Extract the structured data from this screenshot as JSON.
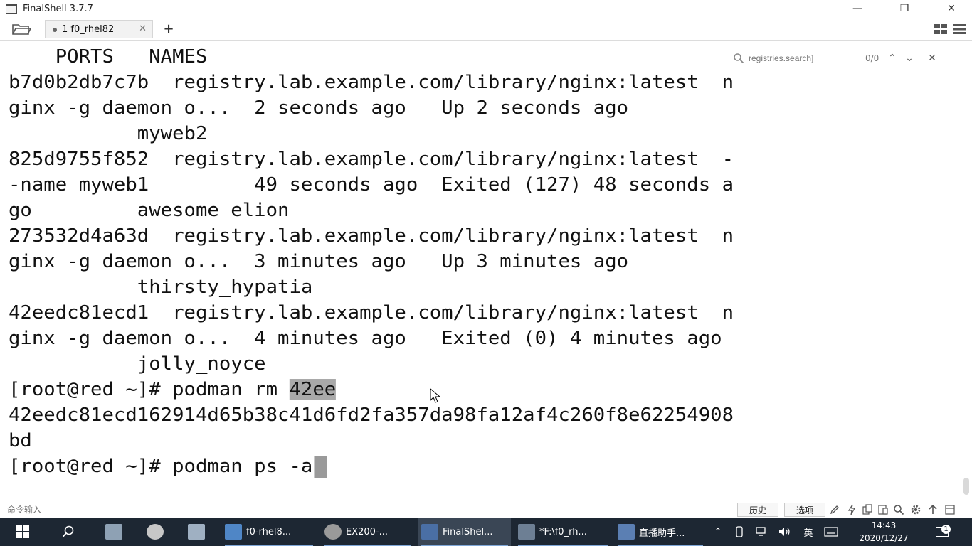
{
  "window": {
    "title": "FinalShell 3.7.7",
    "minimize": "—",
    "maximize": "❐",
    "close": "✕"
  },
  "tabs": [
    {
      "label": "1 f0_rhel82",
      "close": "✕"
    }
  ],
  "add_tab": "+",
  "search": {
    "placeholder": "registries.search]",
    "count": "0/0",
    "prev": "⌃",
    "next": "⌄",
    "close": "✕"
  },
  "terminal": {
    "lines": [
      "    PORTS   NAMES",
      "b7d0b2db7c7b  registry.lab.example.com/library/nginx:latest  n",
      "ginx -g daemon o...  2 seconds ago   Up 2 seconds ago",
      "           myweb2",
      "825d9755f852  registry.lab.example.com/library/nginx:latest  -",
      "-name myweb1         49 seconds ago  Exited (127) 48 seconds a",
      "go         awesome_elion",
      "273532d4a63d  registry.lab.example.com/library/nginx:latest  n",
      "ginx -g daemon o...  3 minutes ago   Up 3 minutes ago",
      "           thirsty_hypatia",
      "42eedc81ecd1  registry.lab.example.com/library/nginx:latest  n",
      "ginx -g daemon o...  4 minutes ago   Exited (0) 4 minutes ago",
      "           jolly_noyce",
      "",
      "42eedc81ecd162914d65b38c41d6fd2fa357da98fa12af4c260f8e62254908",
      "bd",
      ""
    ],
    "rm_prompt": "[root@red ~]# podman rm ",
    "rm_selected": "42ee",
    "ps_prompt": "[root@red ~]# podman ps -a"
  },
  "command_bar": {
    "placeholder": "命令输入",
    "history_label": "历史",
    "options_label": "选项"
  },
  "taskbar": {
    "apps": [
      {
        "label": "f0-rhel8...",
        "color": "#4f86c6"
      },
      {
        "label": "EX200-...",
        "color": "#9a9a9a"
      },
      {
        "label": "FinalShel...",
        "color": "#4a6fa5"
      },
      {
        "label": "*F:\\f0_rh...",
        "color": "#6d7f94"
      },
      {
        "label": "直播助手...",
        "color": "#5b7fb3"
      }
    ],
    "ime": "英",
    "time": "14:43",
    "date": "2020/12/27",
    "notifications": "1"
  }
}
